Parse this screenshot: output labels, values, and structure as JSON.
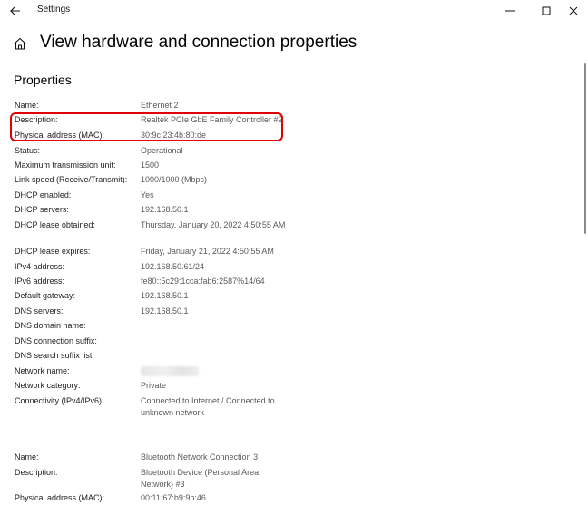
{
  "window": {
    "title": "Settings",
    "controls": [
      "minimize",
      "maximize",
      "close"
    ]
  },
  "page": {
    "title": "View hardware and connection properties",
    "section_heading": "Properties"
  },
  "adapter1": [
    {
      "label": "Name:",
      "value": "Ethernet 2"
    },
    {
      "label": "Description:",
      "value": "Realtek PCIe GbE Family Controller #2"
    },
    {
      "label": "Physical address (MAC):",
      "value": "30:9c:23:4b:80:de"
    },
    {
      "label": "Status:",
      "value": "Operational"
    },
    {
      "label": "Maximum transmission unit:",
      "value": "1500"
    },
    {
      "label": "Link speed (Receive/Transmit):",
      "value": "1000/1000 (Mbps)"
    },
    {
      "label": "DHCP enabled:",
      "value": "Yes"
    },
    {
      "label": "DHCP servers:",
      "value": "192.168.50.1"
    },
    {
      "label": "DHCP lease obtained:",
      "value": "Thursday, January 20, 2022 4:50:55 AM"
    },
    {
      "label": "DHCP lease expires:",
      "value": "Friday, January 21, 2022 4:50:55 AM"
    },
    {
      "label": "IPv4 address:",
      "value": "192.168.50.61/24"
    },
    {
      "label": "IPv6 address:",
      "value": "fe80::5c29:1cca:fab6:2587%14/64"
    },
    {
      "label": "Default gateway:",
      "value": "192.168.50.1"
    },
    {
      "label": "DNS servers:",
      "value": "192.168.50.1"
    },
    {
      "label": "DNS domain name:",
      "value": ""
    },
    {
      "label": "DNS connection suffix:",
      "value": ""
    },
    {
      "label": "DNS search suffix list:",
      "value": ""
    },
    {
      "label": "Network name:",
      "value": ""
    },
    {
      "label": "Network category:",
      "value": "Private"
    },
    {
      "label": "Connectivity (IPv4/IPv6):",
      "value": "Connected to Internet / Connected to unknown network"
    }
  ],
  "adapter2": [
    {
      "label": "Name:",
      "value": "Bluetooth Network Connection 3"
    },
    {
      "label": "Description:",
      "value": "Bluetooth Device (Personal Area Network) #3"
    },
    {
      "label": "Physical address (MAC):",
      "value": "00:11:67:b9:9b:46"
    }
  ],
  "colors": {
    "highlight": "#e00000",
    "label": "#222222",
    "value": "#5a5a5a"
  }
}
